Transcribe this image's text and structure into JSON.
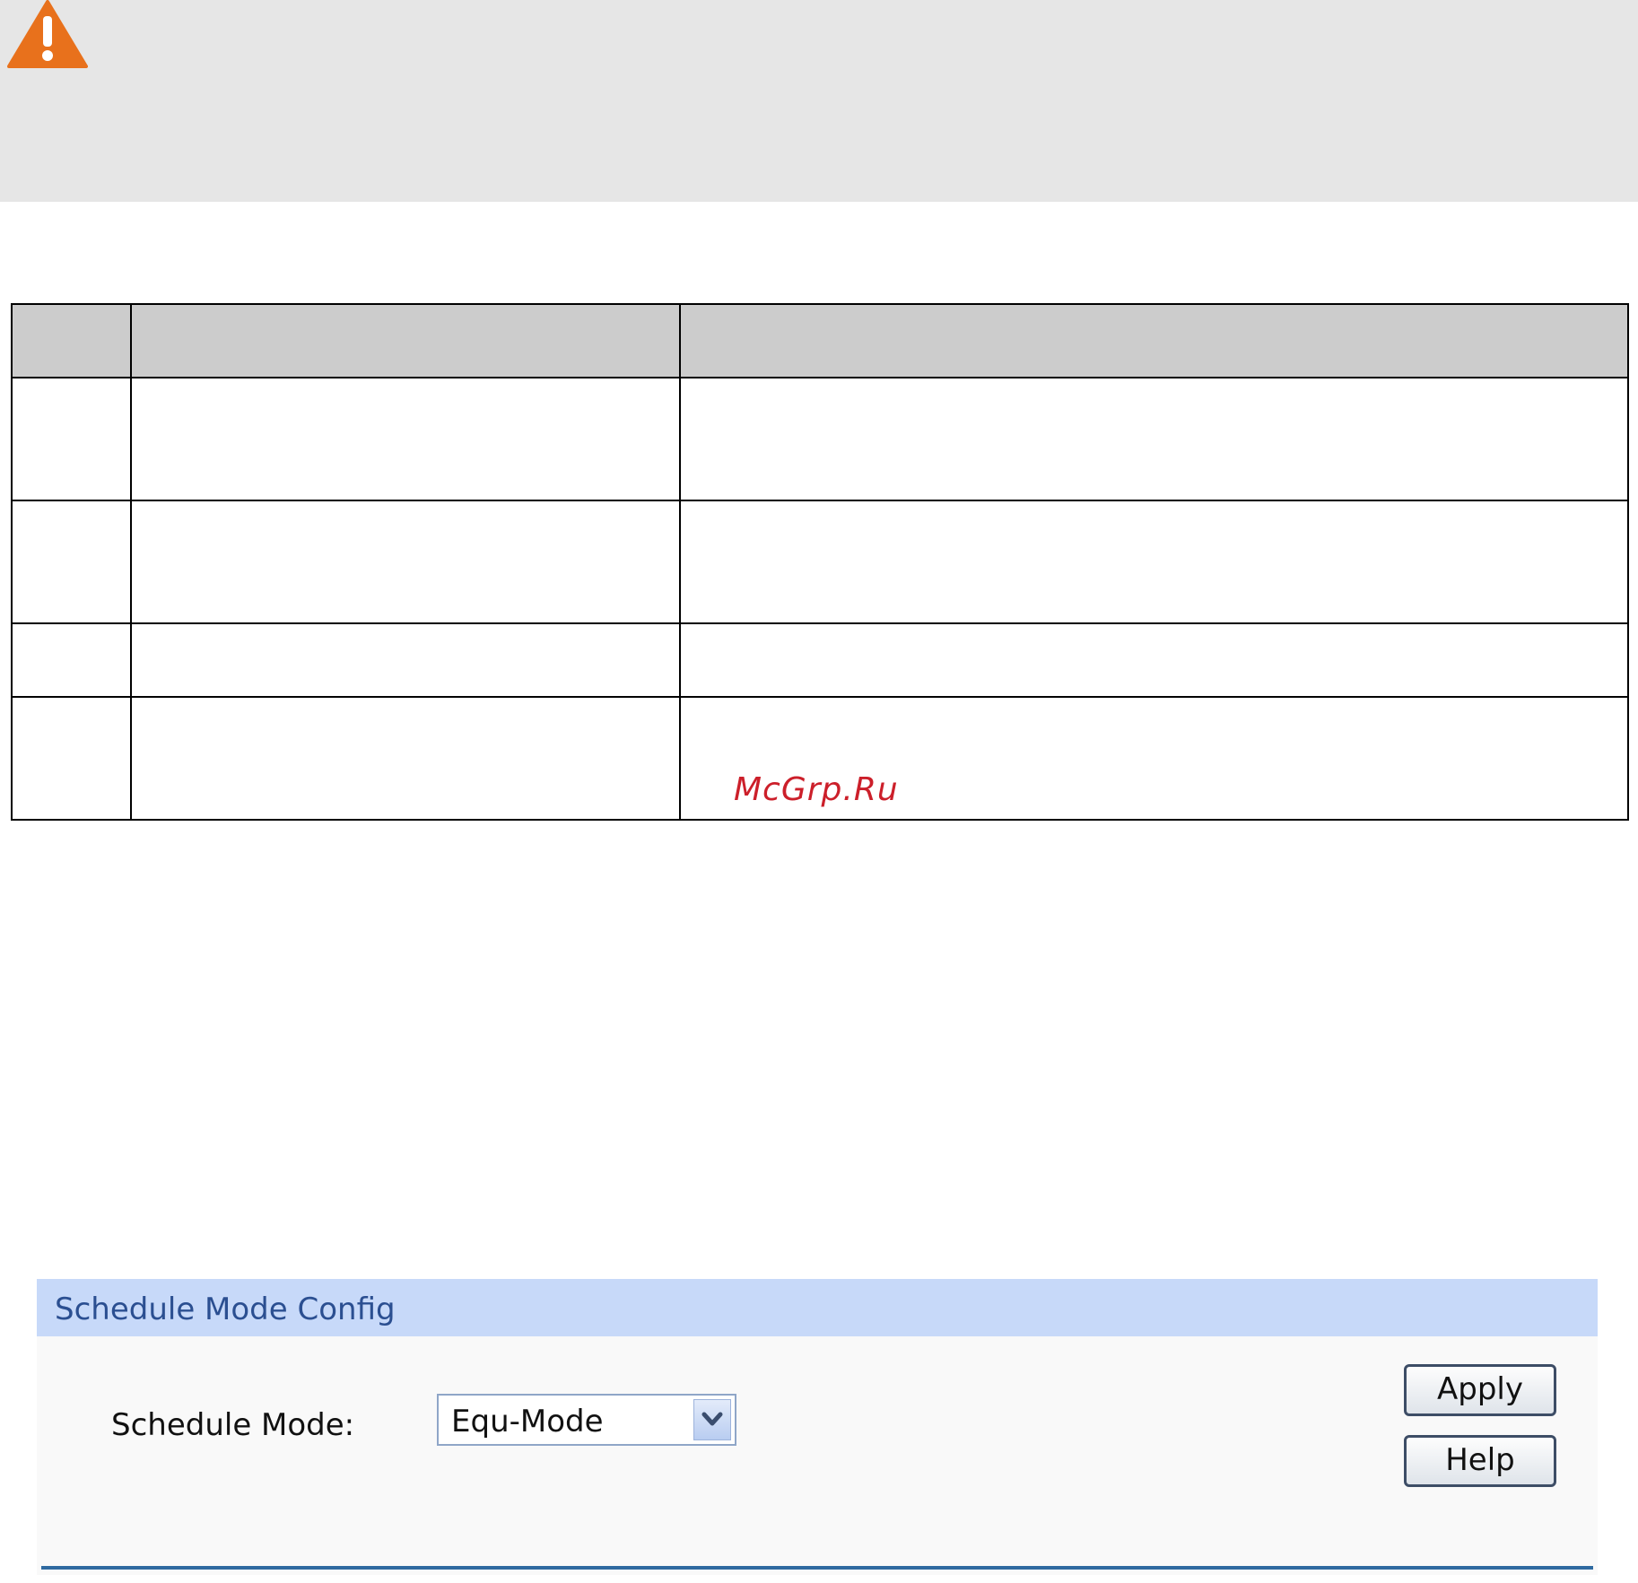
{
  "watermark": "McGrp.Ru",
  "schedule_panel": {
    "title": "Schedule Mode Config",
    "field_label": "Schedule Mode:",
    "select_value": "Equ-Mode",
    "apply_label": "Apply",
    "help_label": "Help"
  },
  "colors": {
    "warning_orange": "#e8711c",
    "header_blue": "#c7d9f9",
    "title_blue": "#2b4f91"
  },
  "icons": [
    "warning-icon",
    "chevron-down-icon"
  ]
}
